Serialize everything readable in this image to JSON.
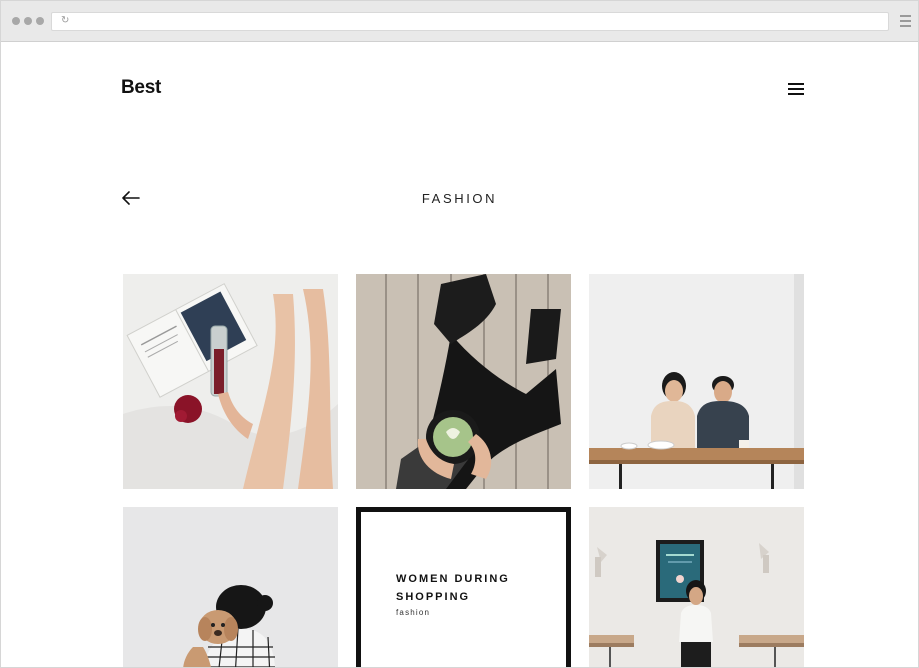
{
  "browser": {
    "url": "",
    "icons": {
      "reload": "reload-icon",
      "menu": "browser-menu-icon"
    }
  },
  "header": {
    "logo": "Best",
    "menu_icon": "hamburger-menu-icon"
  },
  "category": {
    "back_icon": "arrow-left-icon",
    "title": "FASHION"
  },
  "grid": {
    "tiles": [
      {
        "kind": "photo",
        "subject": "magazine-and-drink-on-bed-photo"
      },
      {
        "kind": "photo",
        "subject": "matcha-latte-on-wooden-floor-photo"
      },
      {
        "kind": "photo",
        "subject": "couple-at-cafe-table-photo"
      },
      {
        "kind": "photo",
        "subject": "woman-with-dog-photo"
      },
      {
        "kind": "post",
        "title_line1": "WOMEN DURING",
        "title_line2": "SHOPPING",
        "category": "fashion"
      },
      {
        "kind": "photo",
        "subject": "woman-in-cafe-photo"
      }
    ]
  }
}
